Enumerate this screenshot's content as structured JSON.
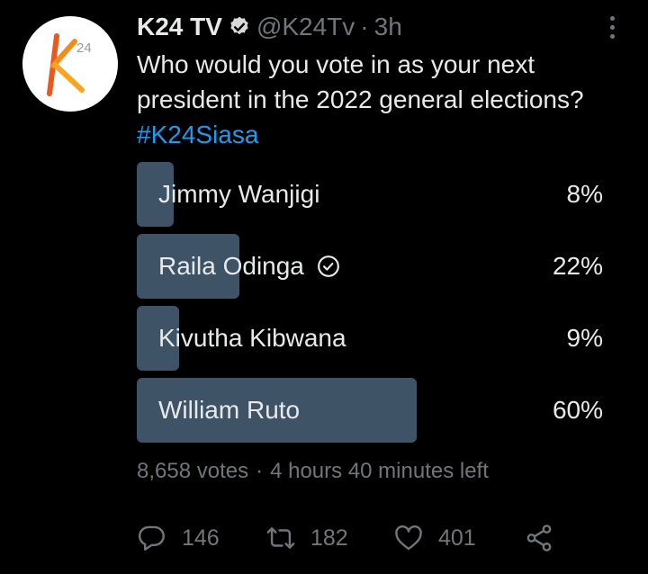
{
  "colors": {
    "background": "#000000",
    "text": "#e7e9ea",
    "secondary": "#71767b",
    "link": "#1d9bf0",
    "poll_bar": "#3e5366",
    "logo_orange": "#f28c1b"
  },
  "author": {
    "name": "K24 TV",
    "handle": "@K24Tv",
    "separator": "·",
    "time": "3h",
    "avatar_logo_letter": "K",
    "avatar_logo_superscript": "24"
  },
  "tweet": {
    "text": "Who would you vote in as your next president in the 2022 general elections?",
    "hashtag": "#K24Siasa"
  },
  "poll": {
    "options": [
      {
        "label": "Jimmy Wanjigi",
        "percent": "8%",
        "share": 0.08,
        "selected": false
      },
      {
        "label": "Raila Odinga",
        "percent": "22%",
        "share": 0.22,
        "selected": true
      },
      {
        "label": "Kivutha Kibwana",
        "percent": "9%",
        "share": 0.09,
        "selected": false
      },
      {
        "label": "William Ruto",
        "percent": "60%",
        "share": 0.6,
        "selected": false
      }
    ],
    "votes": "8,658 votes",
    "separator": "·",
    "time_left": "4 hours 40 minutes left"
  },
  "actions": {
    "reply_count": "146",
    "retweet_count": "182",
    "like_count": "401"
  },
  "icons": {
    "verified": "verified-badge-icon",
    "more": "more-options-icon",
    "selected": "check-circle-icon",
    "reply": "reply-icon",
    "retweet": "retweet-icon",
    "like": "heart-icon",
    "share": "share-icon"
  }
}
